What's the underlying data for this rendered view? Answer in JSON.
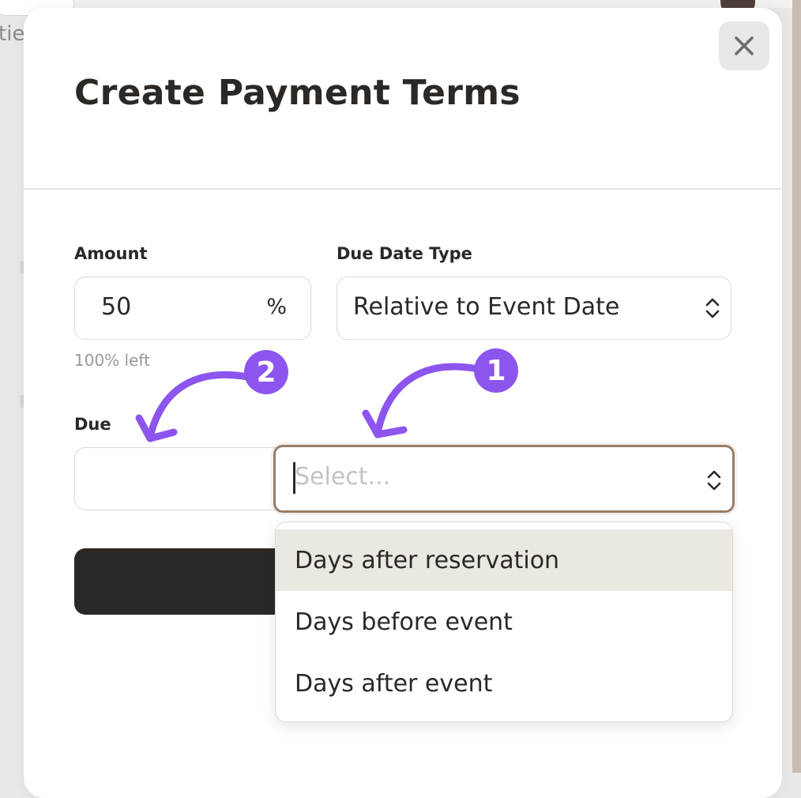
{
  "background": {
    "title_fragment": "tie"
  },
  "modal": {
    "title": "Create Payment Terms",
    "close_icon": "close-icon"
  },
  "amount": {
    "label": "Amount",
    "value": "50",
    "unit": "%",
    "helper": "100% left"
  },
  "due_date_type": {
    "label": "Due Date Type",
    "value": "Relative to Event Date",
    "icon": "chevron-up-down-icon"
  },
  "due": {
    "label": "Due",
    "days_value": "",
    "select_placeholder": "Select...",
    "options": [
      "Days after reservation",
      "Days before event",
      "Days after event"
    ],
    "highlighted_index": 0
  },
  "annotations": {
    "badge_1": "1",
    "badge_2": "2",
    "color": "#8c55ee"
  },
  "colors": {
    "primary": "#2b2826",
    "focus_border": "#9a7d68",
    "highlight": "#ebe7e1"
  }
}
